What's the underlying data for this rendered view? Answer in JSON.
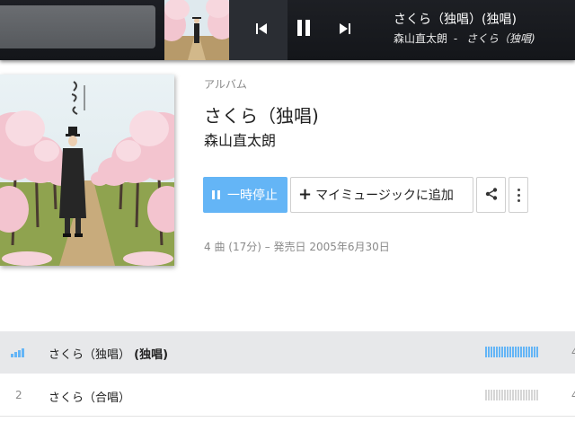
{
  "player": {
    "now_playing_title": "さくら（独唱）(独唱)",
    "now_playing_artist": "森山直太朗",
    "separator": "-",
    "now_playing_album": "さくら（独唱)",
    "controls": [
      "previous-icon",
      "pause-icon",
      "next-icon"
    ]
  },
  "album": {
    "type_label": "アルバム",
    "title": "さくら（独唱)",
    "artist": "森山直太朗",
    "pause_label": "一時停止",
    "add_label": "マイミュージックに追加",
    "meta": "4 曲 (17分) – 発売日 2005年6月30日"
  },
  "tracks": [
    {
      "number": "",
      "title": "さくら（独唱）",
      "title_suffix": "(独唱)",
      "playing": true,
      "popularity": 1.0,
      "duration": "4"
    },
    {
      "number": "2",
      "title": "さくら（合唱）",
      "title_suffix": "",
      "playing": false,
      "popularity": 0.0,
      "duration": "4"
    }
  ],
  "colors": {
    "accent": "#64b5f6",
    "topbar": "#1b1d22",
    "playing_row": "#e7e8ea",
    "popularity_empty": "#d6d6d6"
  }
}
